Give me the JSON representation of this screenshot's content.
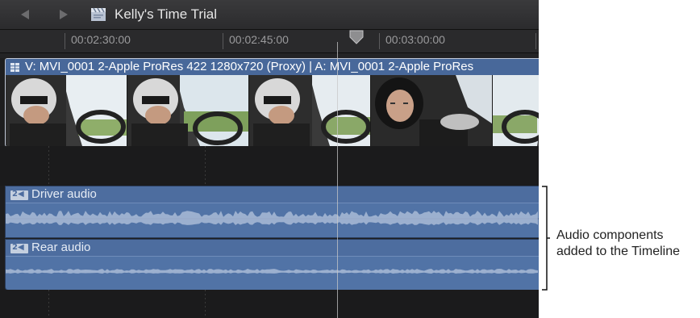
{
  "titlebar": {
    "project_title": "Kelly's Time Trial",
    "back_icon": "back-arrow-icon",
    "forward_icon": "forward-arrow-icon",
    "project_icon": "clapperboard-icon"
  },
  "ruler": {
    "timecodes": [
      "00:02:30:00",
      "00:02:45:00",
      "00:03:00:00"
    ]
  },
  "video_clip": {
    "title": "V: MVI_0001 2-Apple ProRes 422 1280x720 (Proxy)  | A: MVI_0001 2-Apple ProRes",
    "color": "#48689a"
  },
  "audio_components": [
    {
      "label": "Driver audio",
      "badge": "2◀"
    },
    {
      "label": "Rear audio",
      "badge": "2◀"
    }
  ],
  "callout": {
    "text": "Audio components added to the Timeline"
  },
  "colors": {
    "timeline_bg": "#1e1e1f",
    "audio_blue": "#5173a6",
    "waveform": "#a9bbd6"
  }
}
